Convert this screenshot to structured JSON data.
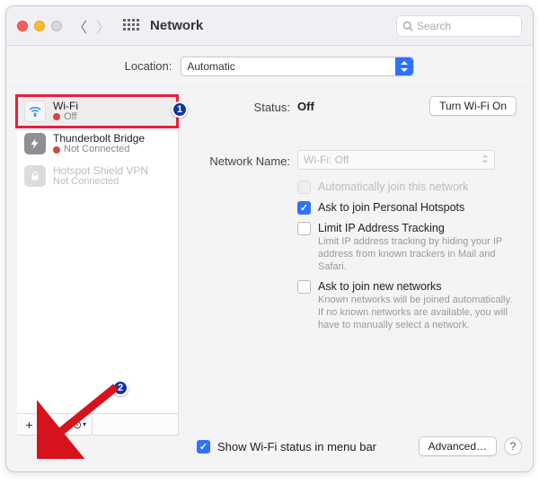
{
  "titlebar": {
    "title": "Network",
    "search_placeholder": "Search"
  },
  "location": {
    "label": "Location:",
    "value": "Automatic"
  },
  "sidebar": {
    "items": [
      {
        "name": "Wi-Fi",
        "status": "Off",
        "selected": true,
        "highlighted": true,
        "icon": "wifi"
      },
      {
        "name": "Thunderbolt Bridge",
        "status": "Not Connected",
        "selected": false,
        "icon": "thunderbolt"
      },
      {
        "name": "Hotspot Shield VPN",
        "status": "Not Connected",
        "selected": false,
        "disabled_look": true,
        "icon": "vpn-lock"
      }
    ]
  },
  "detail": {
    "status_label": "Status:",
    "status_value": "Off",
    "toggle_button": "Turn Wi-Fi On",
    "network_name_label": "Network Name:",
    "network_name_value": "Wi-Fi: Off",
    "options": {
      "auto_join": {
        "label": "Automatically join this network",
        "checked": false,
        "disabled": true
      },
      "ask_personal_hotspots": {
        "label": "Ask to join Personal Hotspots",
        "checked": true
      },
      "limit_ip_tracking": {
        "label": "Limit IP Address Tracking",
        "checked": false,
        "desc": "Limit IP address tracking by hiding your IP address from known trackers in Mail and Safari."
      },
      "ask_new_networks": {
        "label": "Ask to join new networks",
        "checked": false,
        "desc": "Known networks will be joined automatically. If no known networks are available, you will have to manually select a network."
      }
    }
  },
  "footer": {
    "show_status_label": "Show Wi-Fi status in menu bar",
    "show_status_checked": true,
    "advanced_button": "Advanced…"
  },
  "annotations": {
    "badge1": "1",
    "badge2": "2"
  }
}
